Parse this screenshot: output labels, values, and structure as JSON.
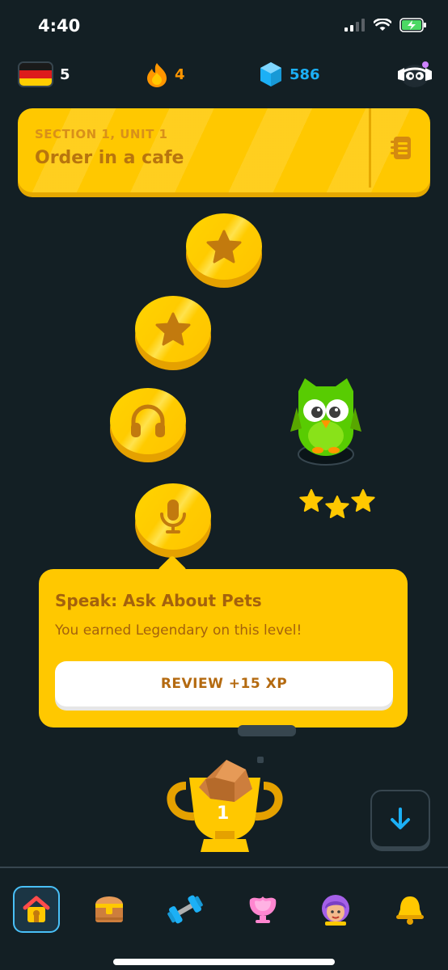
{
  "status_bar": {
    "time": "4:40"
  },
  "stats": {
    "flag_value": "5",
    "streak": "4",
    "gems": "586"
  },
  "unit": {
    "section": "SECTION 1, UNIT 1",
    "title": "Order in a cafe"
  },
  "path": {
    "nodes": [
      {
        "icon": "star-icon"
      },
      {
        "icon": "star-icon"
      },
      {
        "icon": "headphones-icon"
      },
      {
        "icon": "microphone-icon"
      }
    ],
    "stars_earned": 3
  },
  "popup": {
    "title": "Speak: Ask About Pets",
    "subtitle": "You earned Legendary on this level!",
    "button": "REVIEW +15 XP"
  },
  "trophy": {
    "label": "1"
  },
  "nav": {
    "items": [
      "home-icon",
      "treasure-chest-icon",
      "dumbbell-icon",
      "shield-icon",
      "profile-icon",
      "bell-icon"
    ],
    "active": "home-icon"
  },
  "colors": {
    "background": "#131f24",
    "gold": "#ffc800",
    "gem_blue": "#1cb0f6",
    "streak_orange": "#ff9600",
    "owl_green": "#58cc02"
  }
}
